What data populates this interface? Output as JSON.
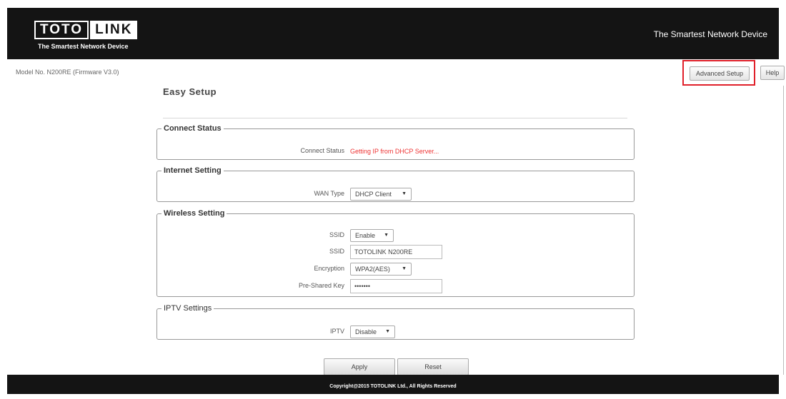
{
  "header": {
    "logo_part1": "TOTO",
    "logo_part2": "LINK",
    "logo_tagline": "The Smartest Network Device",
    "slogan": "The Smartest Network Device"
  },
  "model_info": "Model No. N200RE (Firmware V3.0)",
  "buttons": {
    "advanced_setup": "Advanced Setup",
    "help": "Help",
    "apply": "Apply",
    "reset": "Reset"
  },
  "page_title": "Easy Setup",
  "connect_status": {
    "legend": "Connect Status",
    "label": "Connect Status",
    "value": "Getting IP from DHCP Server..."
  },
  "internet_setting": {
    "legend": "Internet Setting",
    "wan_type_label": "WAN Type",
    "wan_type_value": "DHCP Client"
  },
  "wireless_setting": {
    "legend": "Wireless Setting",
    "ssid_toggle_label": "SSID",
    "ssid_toggle_value": "Enable",
    "ssid_label": "SSID",
    "ssid_value": "TOTOLINK N200RE",
    "encryption_label": "Encryption",
    "encryption_value": "WPA2(AES)",
    "psk_label": "Pre-Shared Key",
    "psk_value": "•••••••"
  },
  "iptv_settings": {
    "legend": "IPTV Settings",
    "iptv_label": "IPTV",
    "iptv_value": "Disable"
  },
  "footer": "Copyright@2015 TOTOLINK Ltd., All Rights Reserved",
  "colors": {
    "header_bg": "#141414",
    "highlight_border": "#e0202a",
    "status_text": "#e33333"
  },
  "icons": {
    "dropdown": "chevron-down-icon"
  }
}
